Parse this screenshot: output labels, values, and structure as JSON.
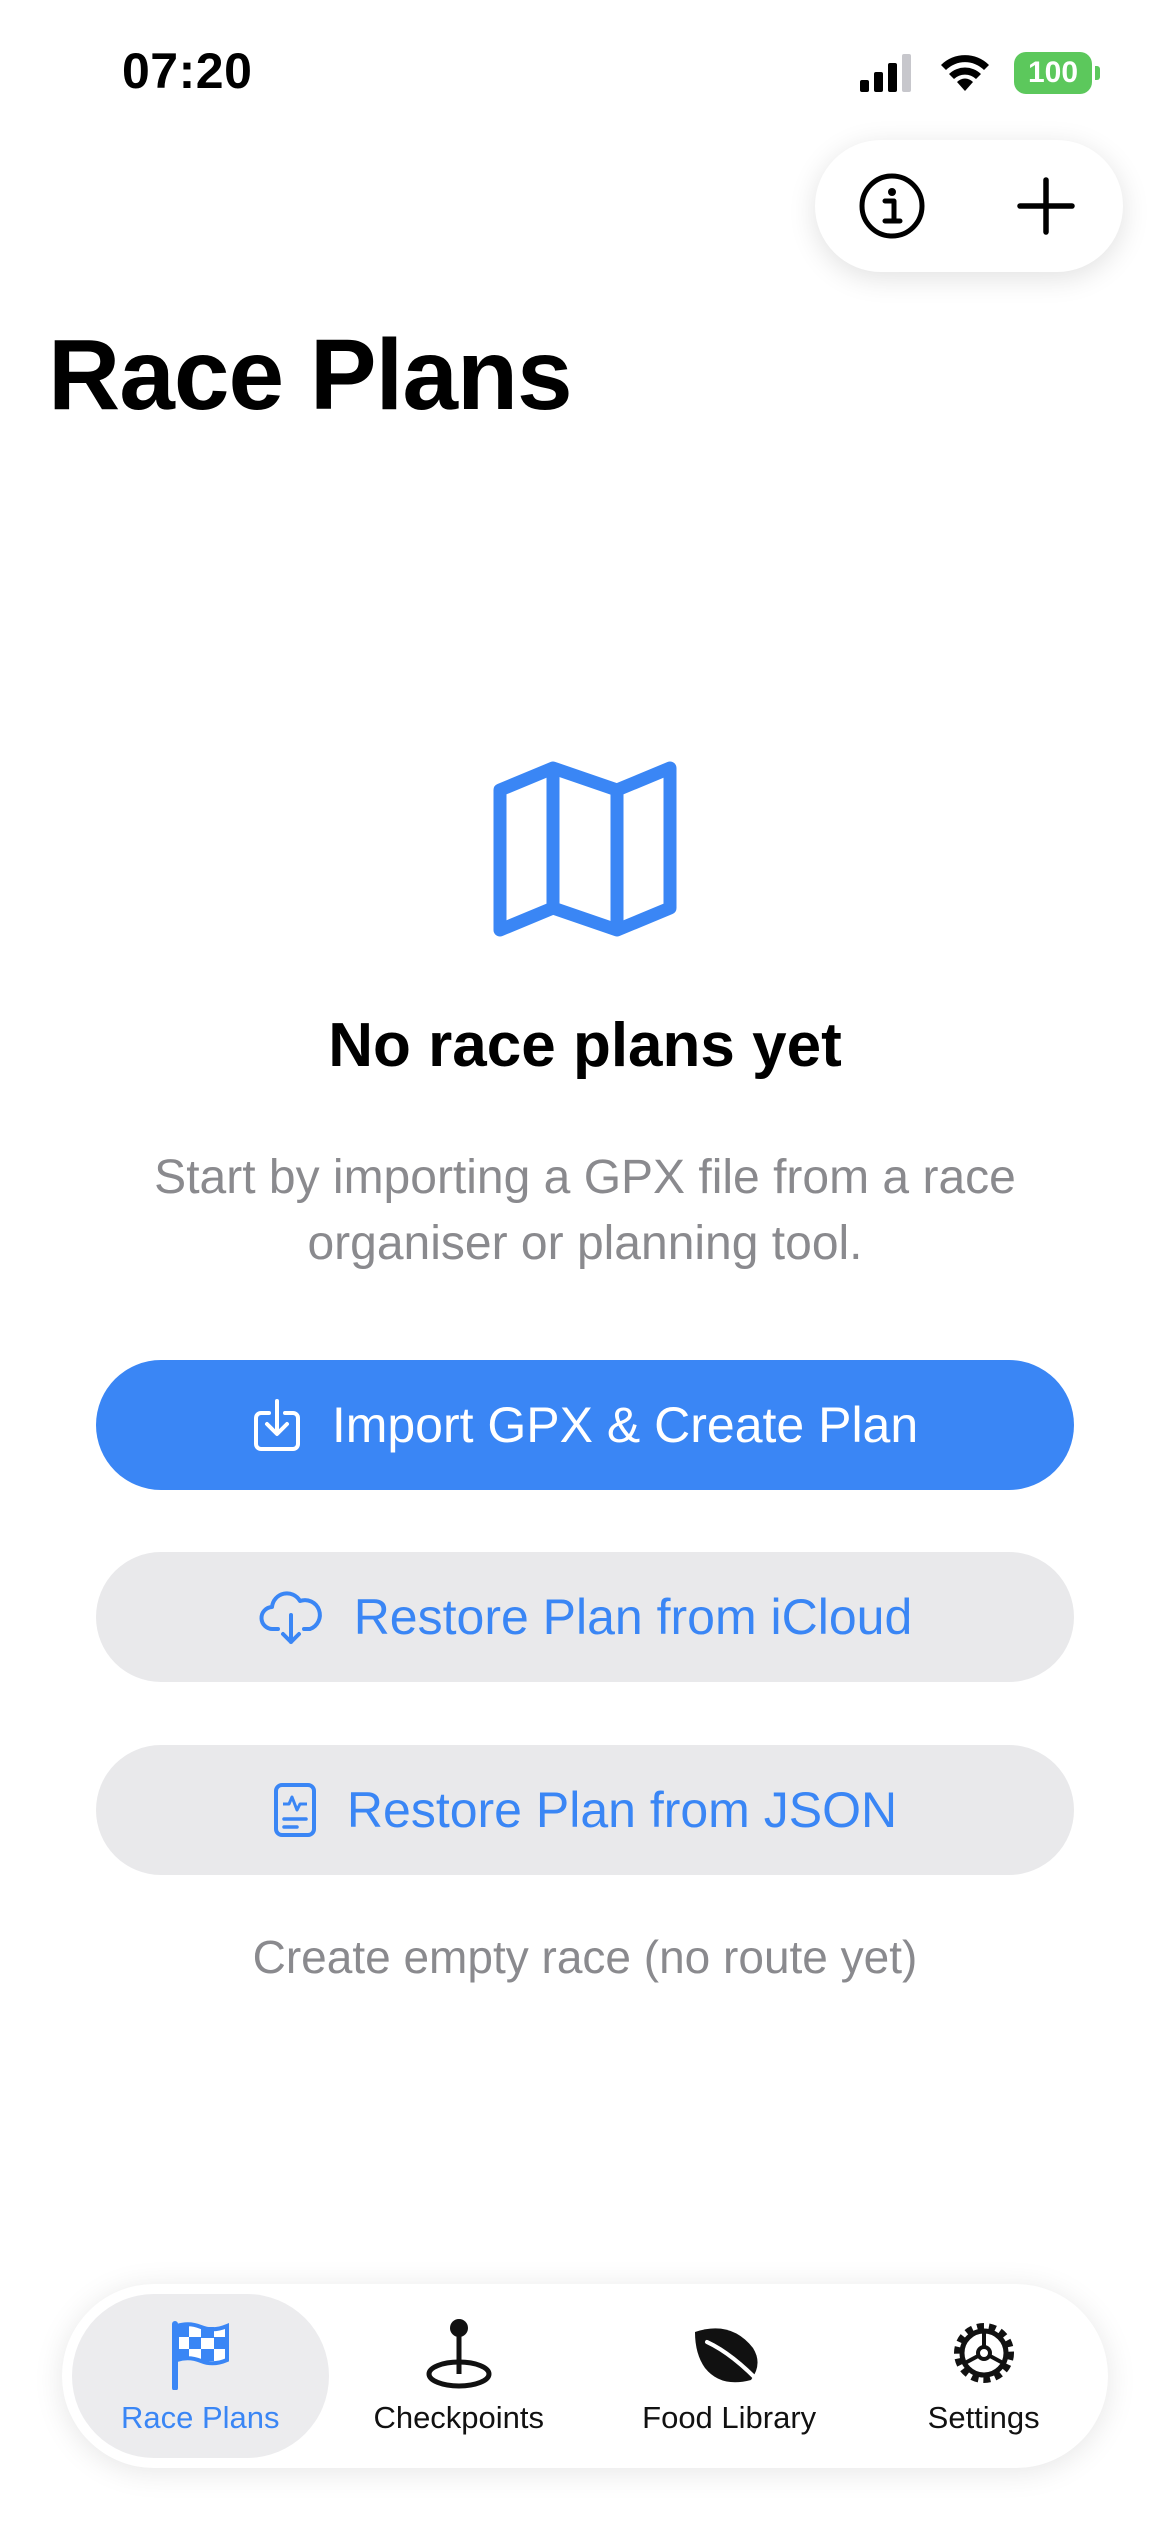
{
  "status": {
    "time": "07:20",
    "battery": "100"
  },
  "header": {
    "title": "Race Plans",
    "info_icon": "info-circle-icon",
    "add_icon": "plus-icon"
  },
  "empty_state": {
    "icon": "map-icon",
    "title": "No race plans yet",
    "subtitle": "Start by importing a GPX file from a race organiser or planning tool."
  },
  "actions": {
    "import_label": "Import GPX & Create Plan",
    "icloud_label": "Restore Plan from iCloud",
    "json_label": "Restore Plan from JSON",
    "empty_race_label": "Create empty race (no route yet)"
  },
  "tabs": [
    {
      "label": "Race Plans",
      "icon": "checkered-flag-icon",
      "active": true
    },
    {
      "label": "Checkpoints",
      "icon": "map-pin-icon",
      "active": false
    },
    {
      "label": "Food Library",
      "icon": "leaf-icon",
      "active": false
    },
    {
      "label": "Settings",
      "icon": "gear-icon",
      "active": false
    }
  ],
  "colors": {
    "accent": "#3a86f5",
    "secondary_bg": "#e9e9eb",
    "muted_text": "#8a8a8e",
    "battery": "#5cc85c"
  }
}
